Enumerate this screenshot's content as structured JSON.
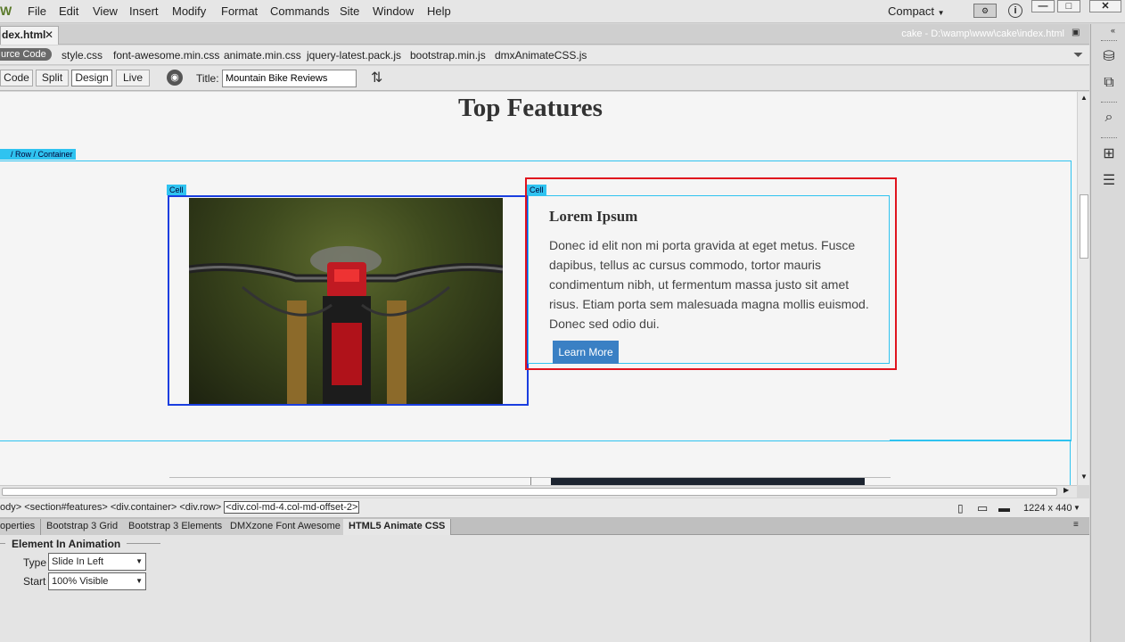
{
  "app": {
    "logo": "W",
    "menus": [
      "File",
      "Edit",
      "View",
      "Insert",
      "Modify",
      "Format",
      "Commands",
      "Site",
      "Window",
      "Help"
    ],
    "workspace": "Compact",
    "window_controls": [
      "—",
      "□",
      "✕"
    ]
  },
  "document": {
    "tab_label": "dex.html",
    "tab_close": "✕",
    "path": "cake - D:\\wamp\\www\\cake\\index.html"
  },
  "related_files": {
    "source_label": "urce Code",
    "files": [
      "style.css",
      "font-awesome.min.css",
      "animate.min.css",
      "jquery-latest.pack.js",
      "bootstrap.min.js",
      "dmxAnimateCSS.js"
    ]
  },
  "doc_toolbar": {
    "views": [
      "Code",
      "Split",
      "Design",
      "Live"
    ],
    "active_view": "Design",
    "title_label": "Title:",
    "title_value": "Mountain Bike Reviews"
  },
  "design": {
    "heading": "Top Features",
    "row_chip": "/ Row / Container",
    "cell_chip_1": "Cell",
    "cell_chip_2": "Cell",
    "card_title": "Lorem Ipsum",
    "card_text": "Donec id elit non mi porta gravida at eget metus. Fusce dapibus, tellus ac cursus commodo, tortor mauris condimentum nibh, ut fermentum massa justo sit amet risus. Etiam porta sem malesuada magna mollis euismod. Donec sed odio dui.",
    "card_button": "Learn More"
  },
  "tag_selector": {
    "tags": [
      "ody>",
      "<section#features>",
      "<div.container>",
      "<div.row>"
    ],
    "current_tag": "<div.col-md-4.col-md-offset-2>",
    "size": "1224 x 440"
  },
  "panel_tabs": {
    "tabs": [
      "operties",
      "Bootstrap 3 Grid",
      "Bootstrap 3 Elements",
      "DMXzone Font Awesome",
      "HTML5 Animate CSS"
    ],
    "active": "HTML5 Animate CSS"
  },
  "animate_panel": {
    "section_title": "Element In Animation",
    "type_label": "Type",
    "type_value": "Slide In Left",
    "start_label": "Start",
    "start_value": "100% Visible"
  },
  "colors": {
    "selection_blue": "#1a3ee0",
    "cell_outline": "#2fc3f0",
    "highlight_red": "#e0141e",
    "button_blue": "#3a80c4"
  }
}
